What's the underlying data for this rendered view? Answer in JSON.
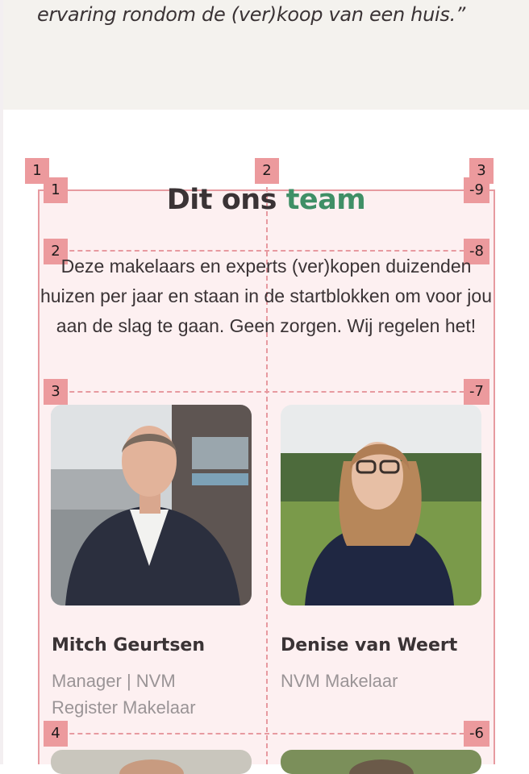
{
  "quote": {
    "text": "ervaring rondom de (ver)koop van een huis.”"
  },
  "team_section": {
    "title_main": "Dit ons ",
    "title_accent": "team",
    "intro": "Deze makelaars en experts (ver)kopen duizenden huizen per jaar en staan in de startblokken om voor jou aan de slag te gaan. Geen zorgen. Wij regelen het!",
    "members": [
      {
        "name": "Mitch Geurtsen",
        "role": "Manager | NVM Register Makelaar"
      },
      {
        "name": "Denise van Weert",
        "role": "NVM Makelaar"
      }
    ]
  },
  "grid_overlay": {
    "color": "#e79aa0",
    "badge_color": "#ec9a9d",
    "column_labels": [
      "1",
      "2",
      "3"
    ],
    "row_labels": [
      "1",
      "2",
      "3",
      "4"
    ],
    "row_neg_labels": [
      "-9",
      "-8",
      "-7",
      "-6"
    ]
  },
  "colors": {
    "accent_green": "#3f8f66",
    "section_bg": "#fdf0f1",
    "quote_bg": "#f4f2ee"
  }
}
